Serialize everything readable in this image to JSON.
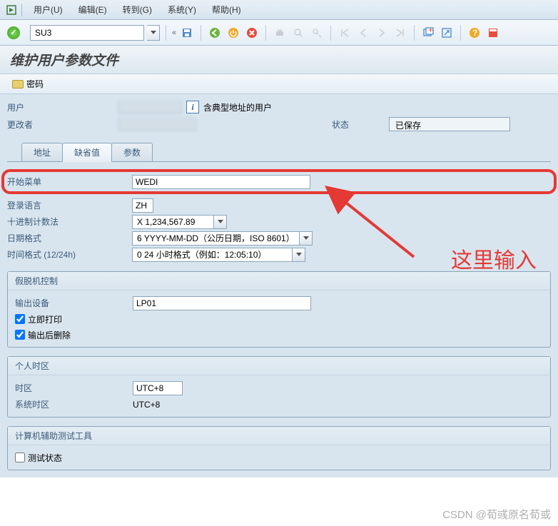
{
  "menu": {
    "user": "用户(U)",
    "edit": "编辑(E)",
    "goto": "转到(G)",
    "system": "系统(Y)",
    "help": "帮助(H)"
  },
  "toolbar": {
    "command": "SU3"
  },
  "title": "维护用户参数文件",
  "subtoolbar": {
    "password": "密码"
  },
  "header": {
    "user_label": "用户",
    "user_desc": "含典型地址的用户",
    "changed_by_label": "更改者",
    "status_label": "状态",
    "status_value": "已保存"
  },
  "tabs": {
    "address": "地址",
    "defaults": "缺省值",
    "parameters": "参数"
  },
  "defaults": {
    "start_menu_label": "开始菜单",
    "start_menu_value": "WEDI",
    "logon_lang_label": "登录语言",
    "logon_lang_value": "ZH",
    "decimal_label": "十进制计数法",
    "decimal_value": "X 1,234,567.89",
    "date_label": "日期格式",
    "date_value": "6 YYYY-MM-DD（公历日期，ISO 8601）",
    "time_label": "时间格式 (12/24h)",
    "time_value": "0 24 小时格式（例如：12:05:10）"
  },
  "spool": {
    "title": "假脱机控制",
    "device_label": "输出设备",
    "device_value": "LP01",
    "print_now": "立即打印",
    "delete_after": "输出后删除"
  },
  "timezone": {
    "title": "个人时区",
    "tz_label": "时区",
    "tz_value": "UTC+8",
    "sys_tz_label": "系统时区",
    "sys_tz_value": "UTC+8"
  },
  "catt": {
    "title": "计算机辅助测试工具",
    "test_status": "测试状态"
  },
  "annotation": "这里输入",
  "watermark": "CSDN @荀彧原名荀或"
}
